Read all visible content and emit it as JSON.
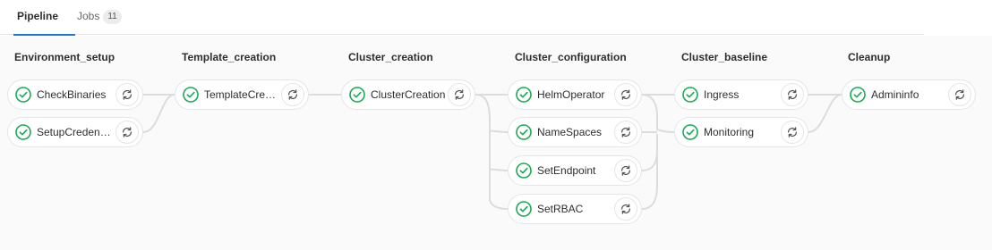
{
  "tabs": {
    "pipeline": "Pipeline",
    "jobs": "Jobs",
    "jobs_count": "11"
  },
  "colors": {
    "success": "#1aaa55",
    "active_tab": "#1f78d1"
  },
  "icons": {
    "status": "status-success-icon",
    "retry": "retry-icon"
  },
  "stages": [
    {
      "name": "Environment_setup",
      "jobs": [
        "CheckBinaries",
        "SetupCredenti…"
      ]
    },
    {
      "name": "Template_creation",
      "jobs": [
        "TemplateCreati…"
      ]
    },
    {
      "name": "Cluster_creation",
      "jobs": [
        "ClusterCreation"
      ]
    },
    {
      "name": "Cluster_configuration",
      "jobs": [
        "HelmOperator",
        "NameSpaces",
        "SetEndpoint",
        "SetRBAC"
      ]
    },
    {
      "name": "Cluster_baseline",
      "jobs": [
        "Ingress",
        "Monitoring"
      ]
    },
    {
      "name": "Cleanup",
      "jobs": [
        "Admininfo"
      ]
    }
  ]
}
